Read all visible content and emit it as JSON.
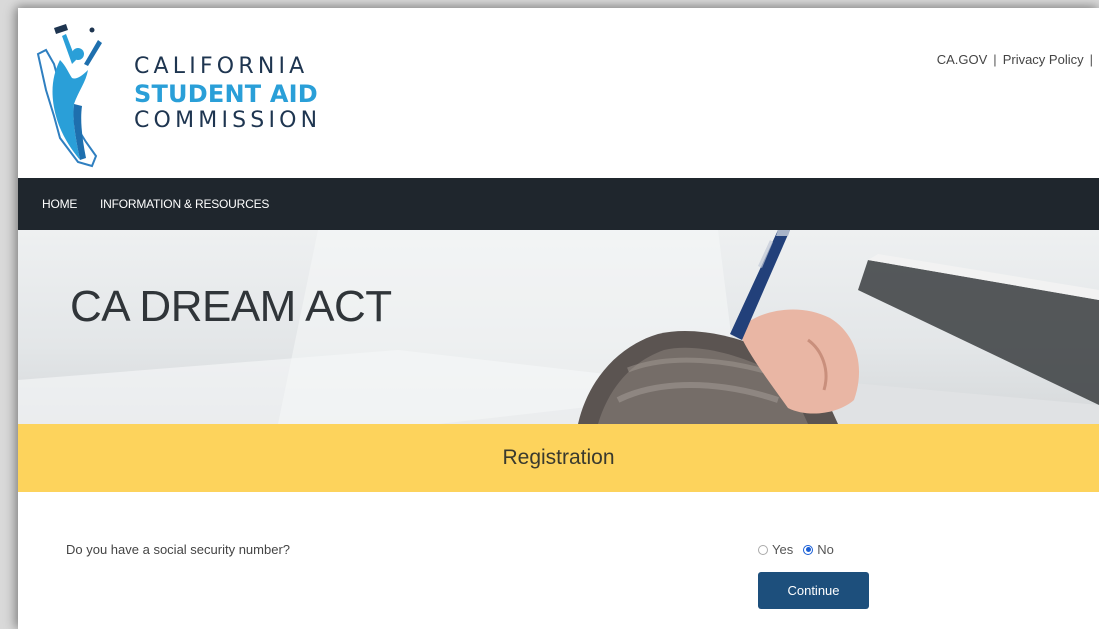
{
  "logo": {
    "line1": "CALIFORNIA",
    "line2": "STUDENT AID",
    "line3": "COMMISSION"
  },
  "top_links": {
    "cagov": "CA.GOV",
    "separator": "|",
    "privacy": "Privacy Policy"
  },
  "nav": {
    "home": "HOME",
    "info": "INFORMATION & RESOURCES"
  },
  "hero": {
    "title": "CA DREAM ACT"
  },
  "band": {
    "title": "Registration"
  },
  "form": {
    "question": "Do you have a social security number?",
    "options": [
      {
        "label": "Yes",
        "selected": false
      },
      {
        "label": "No",
        "selected": true
      }
    ],
    "continue_label": "Continue"
  },
  "colors": {
    "nav_bg": "#1f262d",
    "band_bg": "#fdd35c",
    "button_bg": "#1d4f7c",
    "logo_dark": "#1e3550",
    "logo_blue": "#2a9fd8"
  }
}
